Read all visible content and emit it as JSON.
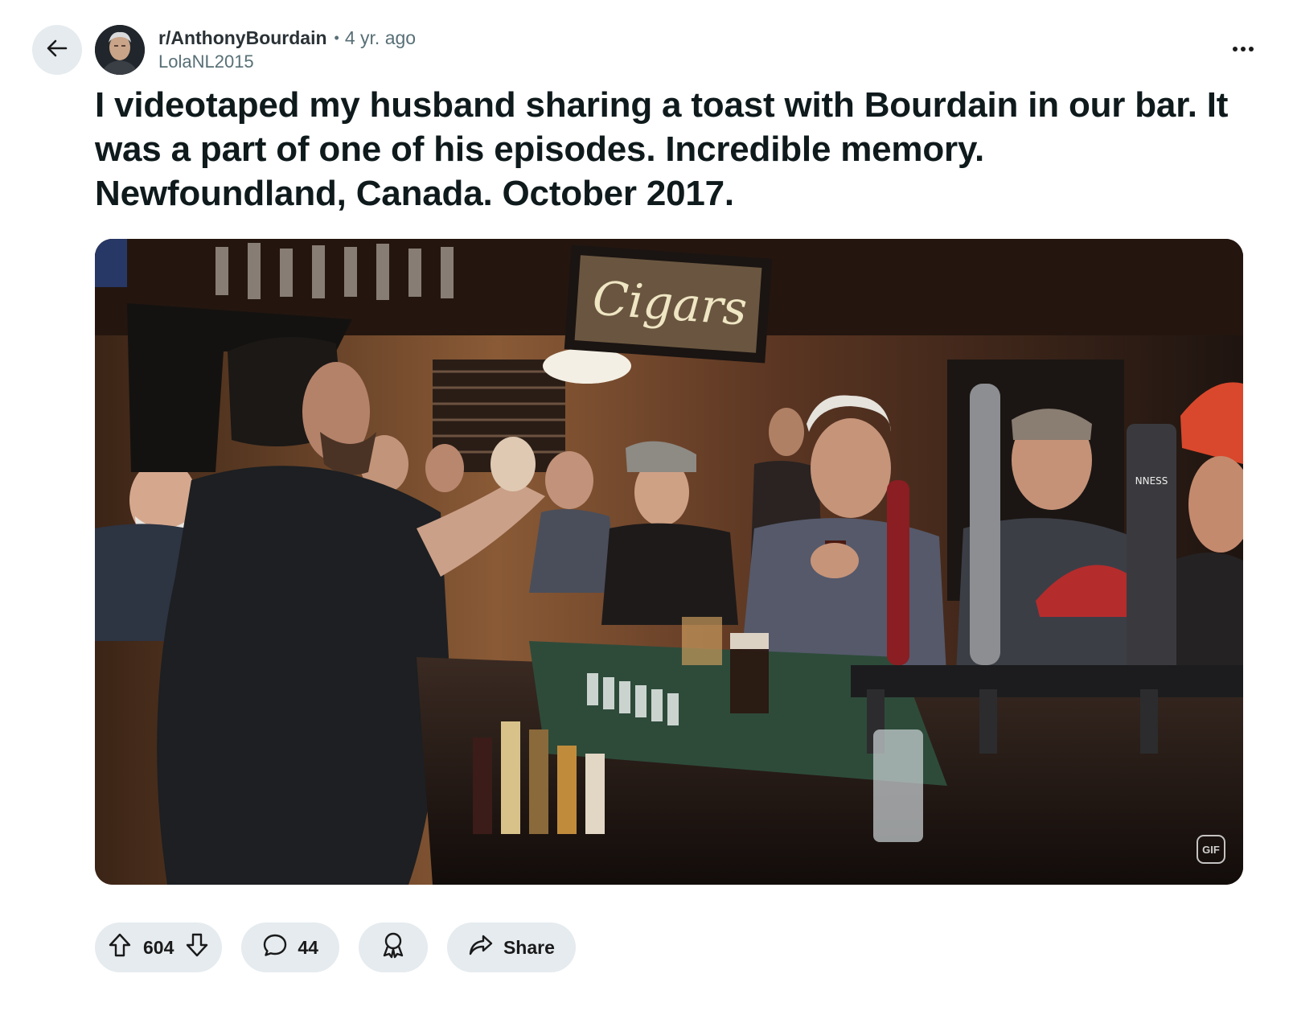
{
  "post": {
    "subreddit": "r/AnthonyBourdain",
    "separator": "•",
    "age": "4 yr. ago",
    "author": "LolaNL2015",
    "title": "I videotaped my husband sharing a toast with Bourdain in our bar. It was a part of one of his episodes. Incredible memory. Newfoundland, Canada. October 2017.",
    "media": {
      "type": "gif",
      "sign_text": "Cigars",
      "tap_brand_text": "NNESS",
      "badge": "GIF"
    }
  },
  "actions": {
    "upvotes": "604",
    "comments": "44",
    "share_label": "Share"
  },
  "icons": {
    "back": "arrow-left-icon",
    "overflow": "more-horizontal-icon",
    "upvote": "arrow-up-icon",
    "downvote": "arrow-down-icon",
    "comment": "speech-bubble-icon",
    "award": "award-icon",
    "share": "share-arrow-icon"
  },
  "colors": {
    "pill_background": "#e5ebee",
    "meta_text": "#576f76",
    "title_text": "#0f1a1c"
  }
}
